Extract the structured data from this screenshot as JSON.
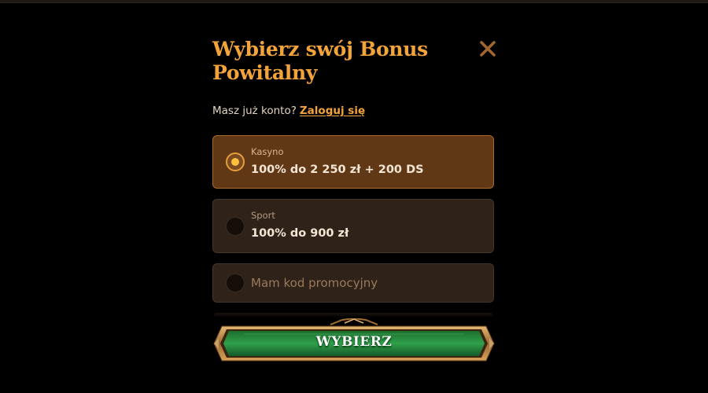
{
  "modal": {
    "title": "Wybierz swój Bonus Powitalny",
    "close_icon": "close-icon",
    "login_prompt": "Masz już konto?",
    "login_link": "Zaloguj się"
  },
  "options": [
    {
      "label": "Kasyno",
      "value": "100% do 2 250 zł + 200 DS",
      "selected": true
    },
    {
      "label": "Sport",
      "value": "100% do 900 zł",
      "selected": false
    },
    {
      "label": "",
      "value": "Mam kod promocyjny",
      "selected": false
    }
  ],
  "cta": {
    "label": "WYBIERZ"
  },
  "colors": {
    "accent": "#f2a33a",
    "selected_bg": "#613816",
    "option_bg": "#2e2219",
    "cta_green": "#1f8a3a"
  }
}
